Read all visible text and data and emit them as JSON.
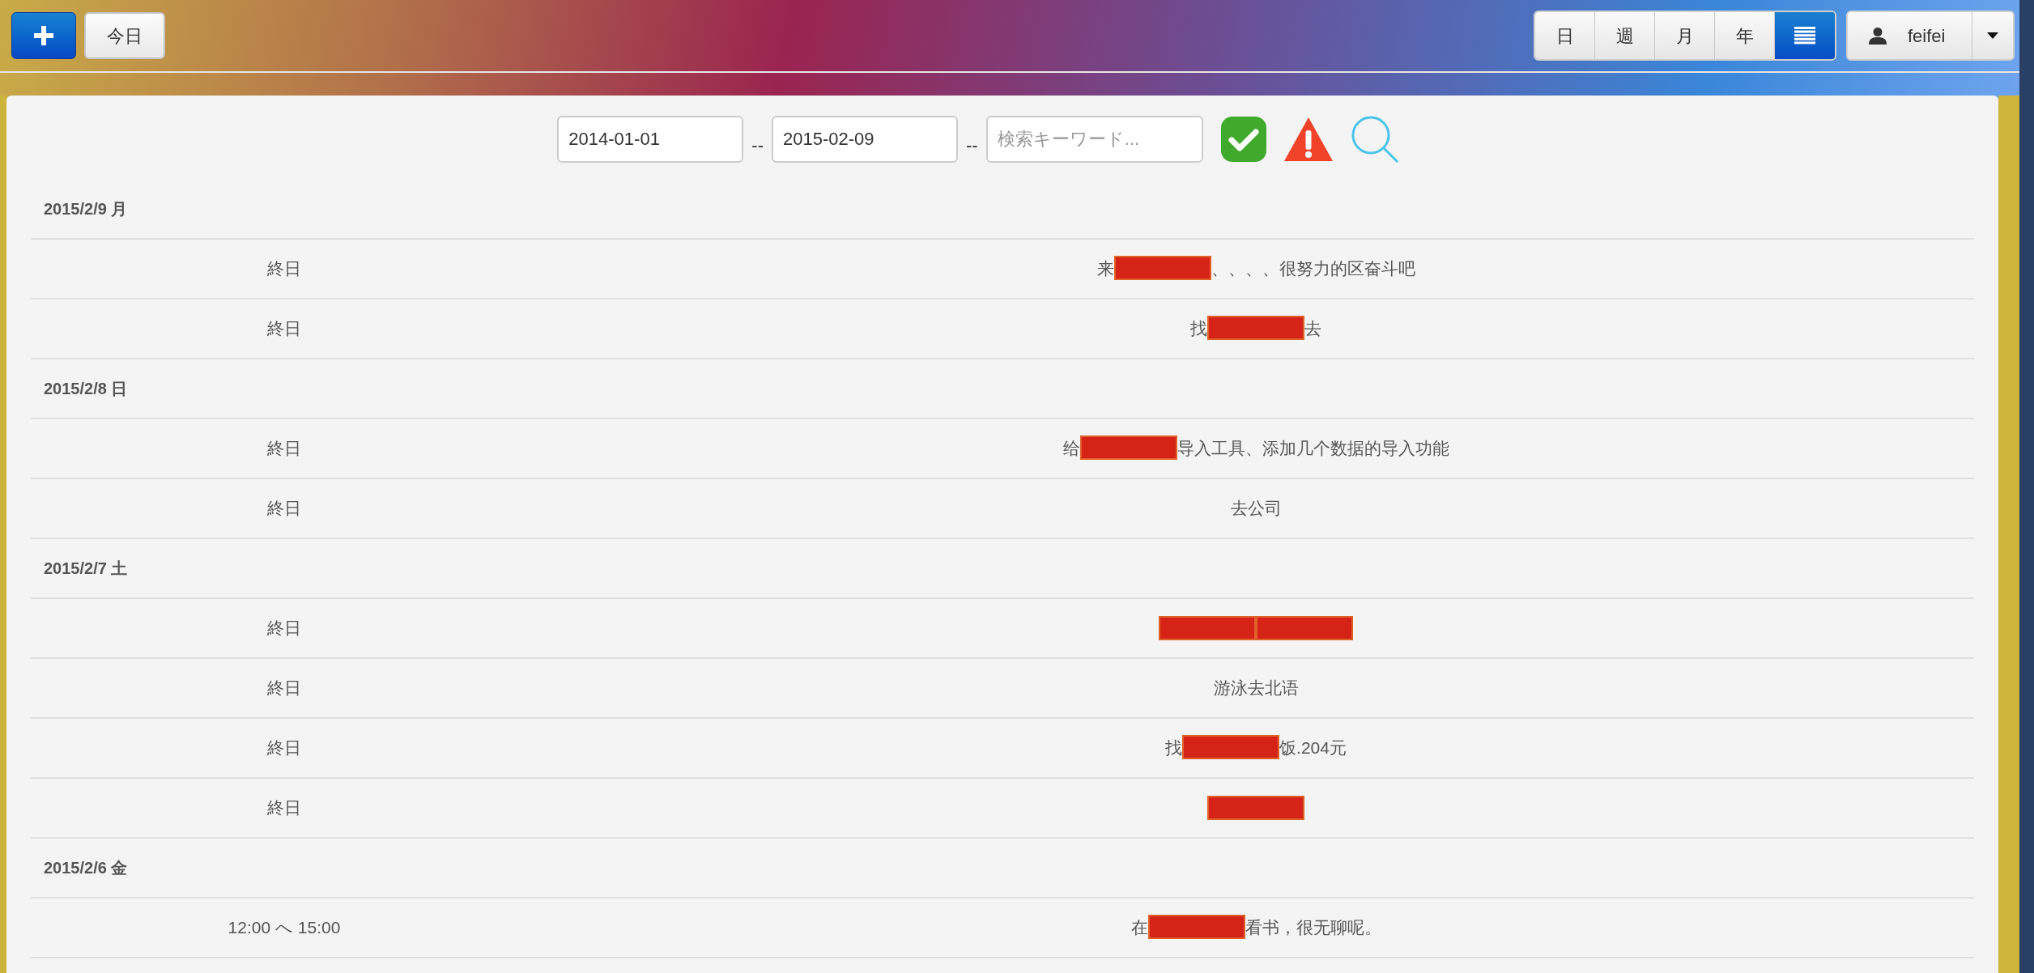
{
  "toolbar": {
    "today_button": "今日"
  },
  "views": [
    {
      "kind": "text",
      "label": "日",
      "selected": false
    },
    {
      "kind": "text",
      "label": "週",
      "selected": false
    },
    {
      "kind": "text",
      "label": "月",
      "selected": false
    },
    {
      "kind": "text",
      "label": "年",
      "selected": false
    },
    {
      "kind": "icon",
      "selected": true
    }
  ],
  "user": {
    "name": "feifei"
  },
  "filter": {
    "start_date": "2014-01-01",
    "separator_1": "--",
    "end_date": "2015-02-09",
    "separator_2": "--",
    "keyword_placeholder": "検索キーワード..."
  },
  "days": [
    {
      "date": "2015/2/9 月",
      "events": [
        {
          "time": "終日",
          "parts": [
            {
              "kind": "text",
              "text": "来"
            },
            {
              "kind": "redaction"
            },
            {
              "kind": "text",
              "text": "、、、、很努力的区奋斗吧"
            }
          ]
        },
        {
          "time": "終日",
          "parts": [
            {
              "kind": "text",
              "text": "找"
            },
            {
              "kind": "redaction"
            },
            {
              "kind": "text",
              "text": "去"
            }
          ]
        }
      ]
    },
    {
      "date": "2015/2/8 日",
      "events": [
        {
          "time": "終日",
          "parts": [
            {
              "kind": "text",
              "text": "给"
            },
            {
              "kind": "redaction"
            },
            {
              "kind": "text",
              "text": "导入工具、添加几个数据的导入功能"
            }
          ]
        },
        {
          "time": "終日",
          "parts": [
            {
              "kind": "text",
              "text": "去公司"
            }
          ]
        }
      ]
    },
    {
      "date": "2015/2/7 土",
      "events": [
        {
          "time": "終日",
          "parts": [
            {
              "kind": "redaction"
            },
            {
              "kind": "redaction"
            }
          ]
        },
        {
          "time": "終日",
          "parts": [
            {
              "kind": "text",
              "text": "游泳去北语"
            }
          ]
        },
        {
          "time": "終日",
          "parts": [
            {
              "kind": "text",
              "text": "找"
            },
            {
              "kind": "redaction"
            },
            {
              "kind": "text",
              "text": "饭.204元"
            }
          ]
        },
        {
          "time": "終日",
          "parts": [
            {
              "kind": "redaction"
            }
          ]
        }
      ]
    },
    {
      "date": "2015/2/6 金",
      "events": [
        {
          "time": "12:00 へ 15:00",
          "parts": [
            {
              "kind": "text",
              "text": "在"
            },
            {
              "kind": "redaction"
            },
            {
              "kind": "text",
              "text": "看书，很无聊呢。"
            }
          ]
        }
      ]
    }
  ]
}
